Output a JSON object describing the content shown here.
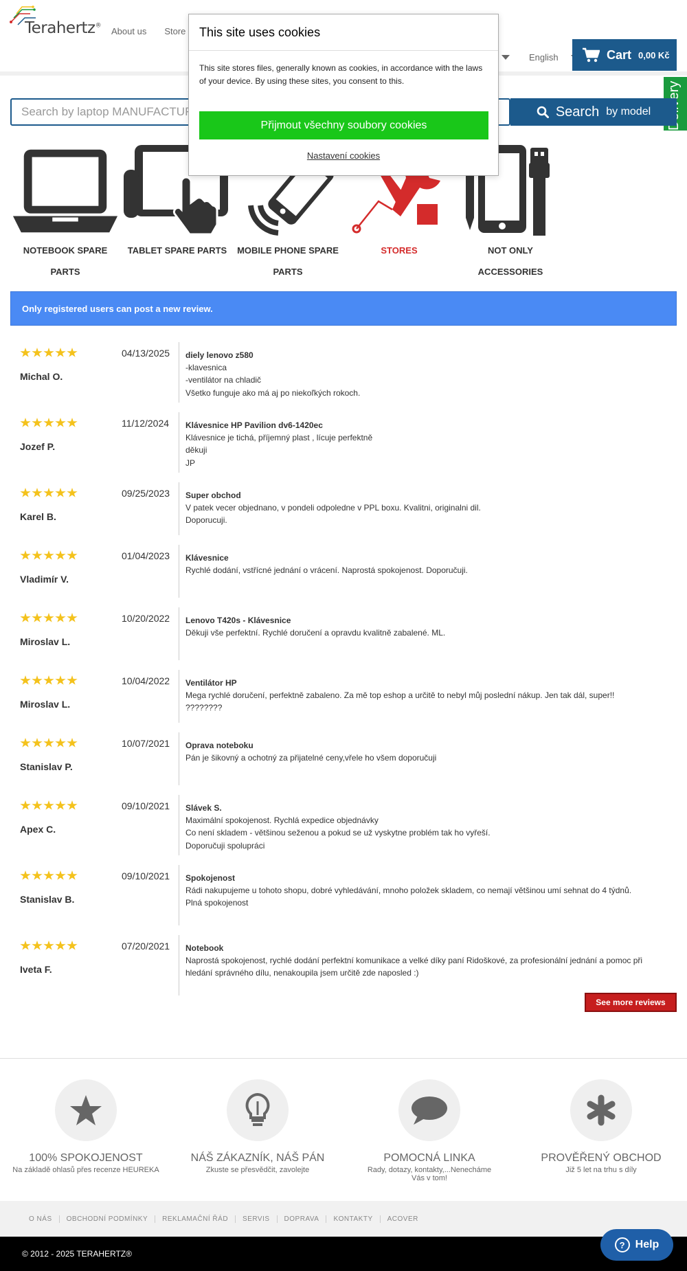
{
  "header": {
    "logo_text": "Terahertz",
    "logo_mark": "®",
    "nav": [
      "About us",
      "Store"
    ],
    "language": "English",
    "cart_label": "Cart",
    "cart_total": "0,00 Kč",
    "delivery_tab": "Delivery"
  },
  "search": {
    "placeholder": "Search by laptop MANUFACTURER",
    "button_main": "Search",
    "button_sub": "by model"
  },
  "categories": [
    {
      "label": "NOTEBOOK SPARE PARTS",
      "icon": "laptop-icon"
    },
    {
      "label": "TABLET SPARE PARTS",
      "icon": "tablet-touch-icon"
    },
    {
      "label": "MOBILE PHONE SPARE PARTS",
      "icon": "phone-icon"
    },
    {
      "label": "STORES",
      "icon": "wrench-screwdriver-icon",
      "color": "#d42b2b"
    },
    {
      "label": "NOT ONLY ACCESSORIES",
      "icon": "accessories-icon"
    }
  ],
  "info_message": "Only registered users can post a new review.",
  "reviews": [
    {
      "date": "04/13/2025",
      "author": "Michal O.",
      "rating": 5,
      "title": "diely lenovo z580",
      "lines": [
        "-klavesnica",
        "-ventilátor na chladič",
        "Všetko funguje ako má aj po niekoľkých rokoch."
      ]
    },
    {
      "date": "11/12/2024",
      "author": "Jozef P.",
      "rating": 5,
      "title": "Klávesnice HP Pavilion dv6-1420ec",
      "lines": [
        "Klávesnice je tichá, příjemný plast , lícuje perfektně",
        "děkuji",
        "JP"
      ]
    },
    {
      "date": "09/25/2023",
      "author": "Karel B.",
      "rating": 5,
      "title": "Super obchod",
      "lines": [
        "V patek vecer objednano, v pondeli odpoledne v PPL boxu. Kvalitni, originalni dil.",
        "Doporucuji."
      ]
    },
    {
      "date": "01/04/2023",
      "author": "Vladimír V.",
      "rating": 5,
      "title": "Klávesnice",
      "lines": [
        "Rychlé dodání, vstřícné jednání o vrácení. Naprostá spokojenost. Doporučuji."
      ]
    },
    {
      "date": "10/20/2022",
      "author": "Miroslav L.",
      "rating": 5,
      "title": "Lenovo T420s - Klávesnice",
      "lines": [
        "Děkuji vše perfektní. Rychlé doručení a opravdu kvalitně zabalené. ML."
      ]
    },
    {
      "date": "10/04/2022",
      "author": "Miroslav L.",
      "rating": 5,
      "title": "Ventilátor HP",
      "lines": [
        "Mega rychlé doručení, perfektně zabaleno. Za mě top eshop a určitě to nebyl můj poslední nákup. Jen tak dál, super!!",
        "????????"
      ]
    },
    {
      "date": "10/07/2021",
      "author": "Stanislav P.",
      "rating": 5,
      "title": "Oprava noteboku",
      "lines": [
        "Pán je šikovný a ochotný za přijatelné ceny,vřele ho všem doporučuji"
      ]
    },
    {
      "date": "09/10/2021",
      "author": "Apex C.",
      "rating": 5,
      "title": "Slávek S.",
      "lines": [
        "Maximální spokojenost. Rychlá expedice objednávky",
        "Co není skladem - většinou seženou a pokud se už vyskytne problém tak ho vyřeší.",
        "Doporučuji spolupráci"
      ]
    },
    {
      "date": "09/10/2021",
      "author": "Stanislav B.",
      "rating": 5,
      "title": "Spokojenost",
      "lines": [
        "Rádi nakupujeme u tohoto shopu, dobré vyhledávání, mnoho položek skladem, co nemají většinou umí sehnat do 4 týdnů.",
        "Plná spokojenost"
      ]
    },
    {
      "date": "07/20/2021",
      "author": "Iveta F.",
      "rating": 5,
      "title": "Notebook",
      "lines": [
        "Naprostá spokojenost, rychlé dodání perfektní komunikace a velké díky paní Ridoškové, za profesionální jednání a pomoc při hledání správného dílu, nenakoupila jsem určitě zde naposled :)"
      ]
    }
  ],
  "more_reviews": "See more reviews",
  "features": [
    {
      "title": "100% SPOKOJENOST",
      "sub": "Na základě ohlasů přes recenze HEUREKA",
      "icon": "star-icon"
    },
    {
      "title": "NÁŠ ZÁKAZNÍK, NÁŠ PÁN",
      "sub": "Zkuste se přesvědčit, zavolejte",
      "icon": "lightbulb-icon"
    },
    {
      "title": "POMOCNÁ LINKA",
      "sub": "Rady, dotazy, kontakty,...Nenecháme Vás v tom!",
      "icon": "speech-bubble-icon"
    },
    {
      "title": "PROVĚŘENÝ OBCHOD",
      "sub": "Již 5 let na trhu s díly",
      "icon": "asterisk-icon"
    }
  ],
  "footer_links": [
    "O NÁS",
    "OBCHODNÍ PODMÍNKY",
    "REKLAMAČNÍ ŘÁD",
    "SERVIS",
    "DOPRAVA",
    "KONTAKTY",
    "ACOVER"
  ],
  "copyright": "© 2012 - 2025 TERAHERTZ®",
  "help_label": "Help",
  "cookie": {
    "title": "This site uses cookies",
    "body": "This site stores files, generally known as cookies, in accordance with the laws of your device. By using these sites, you consent to this.",
    "accept": "Přijmout všechny soubory cookies",
    "settings": "Nastavení cookies"
  },
  "colors": {
    "brand": "#1c5a8c",
    "accept": "#19c719",
    "info": "#4a8af4",
    "star": "#f4c21c",
    "red": "#d42b2b"
  }
}
